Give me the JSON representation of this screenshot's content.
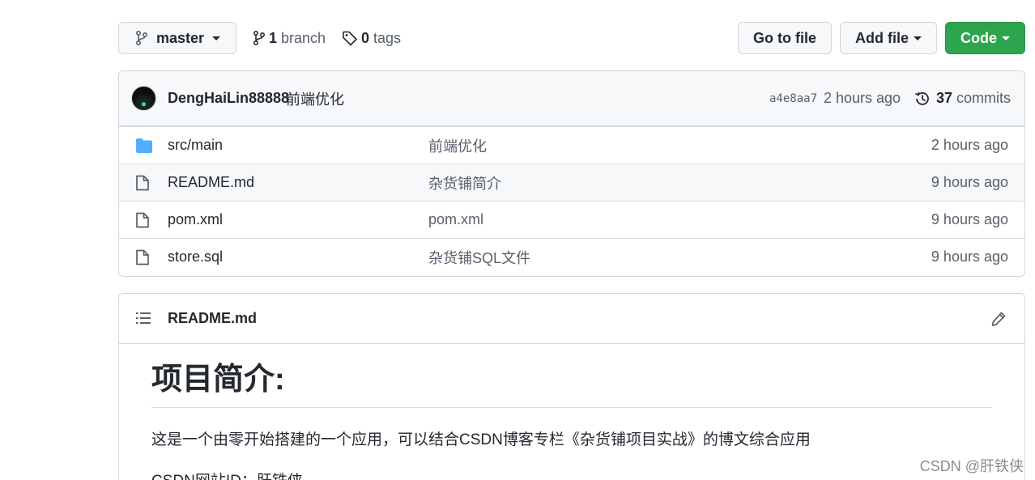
{
  "toolbar": {
    "branch_selector": "master",
    "branch_count": "1",
    "branch_label": "branch",
    "tag_count": "0",
    "tag_label": "tags",
    "go_to_file": "Go to file",
    "add_file": "Add file",
    "code": "Code"
  },
  "commit": {
    "author": "DengHaiLin88888",
    "message": "前端优化",
    "sha": "a4e8aa7",
    "time": "2 hours ago",
    "count": "37",
    "count_label": "commits"
  },
  "files": [
    {
      "icon": "folder-icon",
      "name": "src/main",
      "message": "前端优化",
      "time": "2 hours ago"
    },
    {
      "icon": "file-icon",
      "name": "README.md",
      "message": "杂货铺简介",
      "time": "9 hours ago"
    },
    {
      "icon": "file-icon",
      "name": "pom.xml",
      "message": "pom.xml",
      "time": "9 hours ago"
    },
    {
      "icon": "file-icon",
      "name": "store.sql",
      "message": "杂货铺SQL文件",
      "time": "9 hours ago"
    }
  ],
  "readme": {
    "filename": "README.md",
    "heading": "项目简介:",
    "paragraph1": "这是一个由零开始搭建的一个应用，可以结合CSDN博客专栏《杂货铺项目实战》的博文综合应用",
    "paragraph2": "CSDN网站ID：肝铁侠"
  },
  "watermark": "CSDN @肝铁侠",
  "colors": {
    "accent_green": "#2da44e",
    "folder_blue": "#54aeff",
    "muted_text": "#57606a",
    "border": "#d0d7de"
  }
}
